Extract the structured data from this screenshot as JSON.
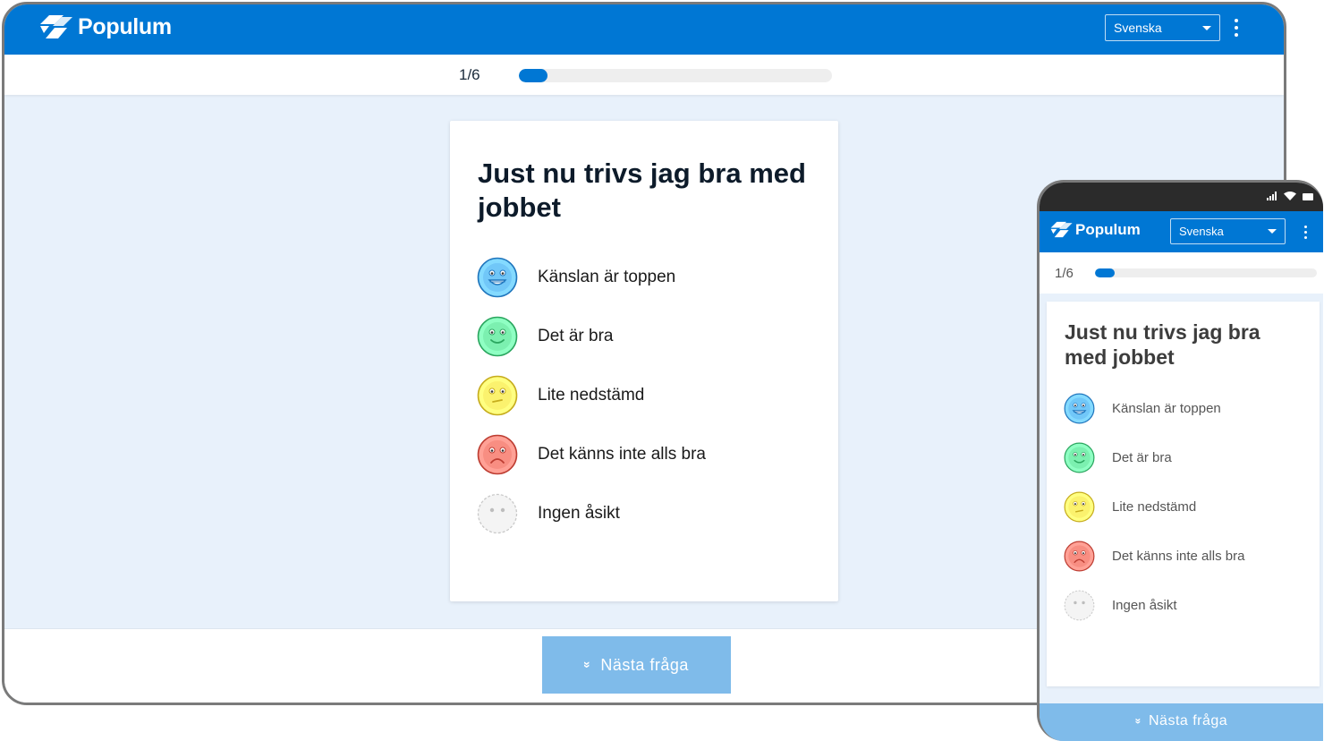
{
  "brand": {
    "name": "Populum",
    "color": "#0077d4",
    "button_color": "#7fbbea"
  },
  "language_select": {
    "selected": "Svenska"
  },
  "progress": {
    "text": "1/6",
    "current": 1,
    "total": 6,
    "fraction": 0.09
  },
  "question": "Just nu trivs jag bra med jobbet",
  "options": [
    {
      "label": "Känslan är toppen",
      "face": "very-happy-face-icon",
      "color": "#4da3ea"
    },
    {
      "label": "Det är bra",
      "face": "happy-face-icon",
      "color": "#58d38c"
    },
    {
      "label": "Lite nedstämd",
      "face": "meh-face-icon",
      "color": "#f3d94a"
    },
    {
      "label": "Det känns inte alls bra",
      "face": "sad-face-icon",
      "color": "#ea6a5f"
    },
    {
      "label": "Ingen åsikt",
      "face": "neutral-face-icon",
      "color": "#cfcfcf"
    }
  ],
  "next_button": {
    "label": "Nästa fråga"
  }
}
